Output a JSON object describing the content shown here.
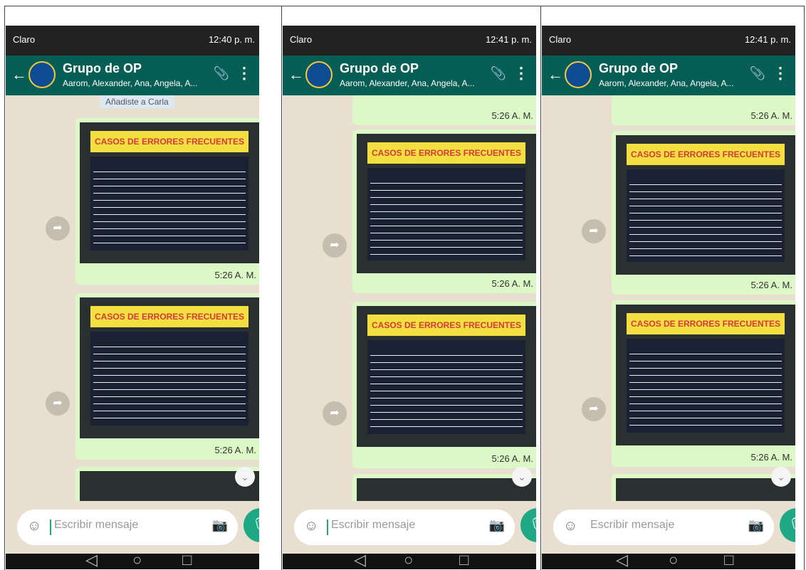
{
  "screens": [
    {
      "status": {
        "carrier": "Claro",
        "time": "12:40 p. m."
      },
      "app": {
        "group": "Grupo de OP",
        "members": "Aarom, Alexander, Ana, Angela, A..."
      },
      "system_message": "Añadiste a Carla",
      "messages": [
        {
          "title": "CASOS DE ERRORES FRECUENTES",
          "time": "5:26 A. M."
        },
        {
          "title": "CASOS DE ERRORES FRECUENTES",
          "time": "5:26 A. M."
        }
      ],
      "composer": {
        "placeholder": "Escribir mensaje"
      },
      "icons": {
        "back": "←",
        "attach": "📎",
        "menu": "⋮",
        "emoji": "☺",
        "camera": "📷",
        "mic": "🎙",
        "share": "➦",
        "scroll": "⌄"
      }
    },
    {
      "status": {
        "carrier": "Claro",
        "time": "12:41 p. m."
      },
      "app": {
        "group": "Grupo de OP",
        "members": "Aarom, Alexander, Ana, Angela, A..."
      },
      "messages": [
        {
          "title": "CASOS DE ERRORES FRECUENTES",
          "time": "5:26 A. M."
        },
        {
          "title": "CASOS DE ERRORES FRECUENTES",
          "time": "5:26 A. M."
        },
        {
          "title": "CASOS DE ERRORES FRECUENTES",
          "time": "5:26 A. M."
        }
      ],
      "composer": {
        "placeholder": "Escribir mensaje"
      }
    },
    {
      "status": {
        "carrier": "Claro",
        "time": "12:41 p. m."
      },
      "app": {
        "group": "Grupo de OP",
        "members": "Aarom, Alexander, Ana, Angela, A..."
      },
      "messages": [
        {
          "title": "CASOS DE ERRORES FRECUENTES",
          "time": "5:26 A. M."
        },
        {
          "title": "CASOS DE ERRORES FRECUENTES",
          "time": "5:26 A. M."
        },
        {
          "title": "CASOS DE ERRORES FRECUENTES",
          "time": "5:26 A. M."
        }
      ],
      "composer": {
        "placeholder": "Escribir mensaje"
      }
    }
  ],
  "colors": {
    "appbar": "#075e54",
    "bubble": "#dcf8c6",
    "accent": "#1fa884"
  }
}
